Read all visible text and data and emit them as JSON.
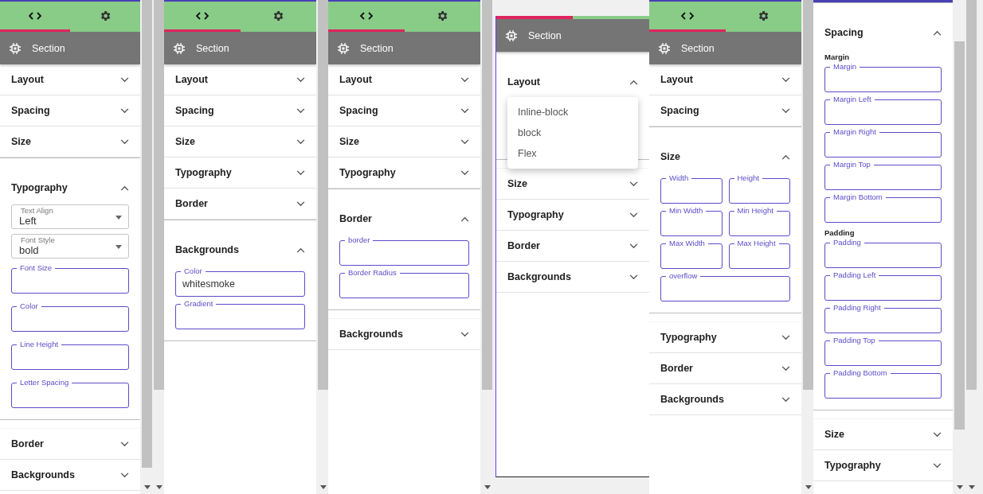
{
  "panels": [
    {
      "tabs": [
        {
          "selected": true
        },
        {
          "selected": false
        }
      ],
      "header": {
        "title": "Section"
      },
      "sections": [
        {
          "title": "Layout",
          "expanded": false
        },
        {
          "title": "Spacing",
          "expanded": false
        },
        {
          "title": "Size",
          "expanded": false
        },
        {
          "title": "Typography",
          "expanded": true,
          "fields": [
            {
              "kind": "select",
              "label": "Text Align",
              "value": "Left"
            },
            {
              "kind": "select",
              "label": "Font Style",
              "value": "bold"
            },
            {
              "kind": "outlined",
              "label": "Font Size"
            },
            {
              "kind": "outlined",
              "label": "Color"
            },
            {
              "kind": "outlined",
              "label": "Line Height"
            },
            {
              "kind": "outlined",
              "label": "Letter Spacing"
            }
          ]
        },
        {
          "title": "Border",
          "expanded": false
        },
        {
          "title": "Backgrounds",
          "expanded": false
        }
      ]
    },
    {
      "tabs": [
        {
          "selected": true
        },
        {
          "selected": false
        }
      ],
      "header": {
        "title": "Section"
      },
      "sections": [
        {
          "title": "Layout",
          "expanded": false
        },
        {
          "title": "Spacing",
          "expanded": false
        },
        {
          "title": "Size",
          "expanded": false
        },
        {
          "title": "Typography",
          "expanded": false
        },
        {
          "title": "Border",
          "expanded": false
        },
        {
          "title": "Backgrounds",
          "expanded": true,
          "fields": [
            {
              "kind": "outlined",
              "label": "Color",
              "value": "whitesmoke"
            },
            {
              "kind": "outlined",
              "label": "Gradient"
            }
          ]
        }
      ]
    },
    {
      "tabs": [
        {
          "selected": true
        },
        {
          "selected": false
        }
      ],
      "header": {
        "title": "Section"
      },
      "sections": [
        {
          "title": "Layout",
          "expanded": false
        },
        {
          "title": "Spacing",
          "expanded": false
        },
        {
          "title": "Size",
          "expanded": false
        },
        {
          "title": "Typography",
          "expanded": false
        },
        {
          "title": "Border",
          "expanded": true,
          "fields": [
            {
              "kind": "outlined",
              "label": "border"
            },
            {
              "kind": "outlined",
              "label": "Border Radius"
            }
          ]
        },
        {
          "title": "Backgrounds",
          "expanded": false
        }
      ]
    },
    {
      "tabs": [
        {
          "selected": true
        },
        {
          "selected": false
        }
      ],
      "header": {
        "title": "Section"
      },
      "sections": [
        {
          "title": "Layout",
          "expanded": true,
          "menu": [
            "Inline-block",
            "block",
            "Flex"
          ]
        },
        {
          "title": "Size",
          "expanded": false
        },
        {
          "title": "Typography",
          "expanded": false
        },
        {
          "title": "Border",
          "expanded": false
        },
        {
          "title": "Backgrounds",
          "expanded": false
        }
      ]
    },
    {
      "tabs": [
        {
          "selected": true
        },
        {
          "selected": false
        }
      ],
      "header": {
        "title": "Section"
      },
      "sections": [
        {
          "title": "Layout",
          "expanded": false
        },
        {
          "title": "Spacing",
          "expanded": false
        },
        {
          "title": "Size",
          "expanded": true,
          "fields": [
            {
              "kind": "outlined-half",
              "label": "Width"
            },
            {
              "kind": "outlined-half",
              "label": "Height"
            },
            {
              "kind": "outlined-half",
              "label": "Min Width"
            },
            {
              "kind": "outlined-half",
              "label": "Min Height"
            },
            {
              "kind": "outlined-half",
              "label": "Max Width"
            },
            {
              "kind": "outlined-half",
              "label": "Max Height"
            },
            {
              "kind": "outlined",
              "label": "overflow"
            }
          ]
        },
        {
          "title": "Typography",
          "expanded": false
        },
        {
          "title": "Border",
          "expanded": false
        },
        {
          "title": "Backgrounds",
          "expanded": false
        }
      ]
    },
    {
      "sections": [
        {
          "title": "Spacing",
          "expanded": true,
          "fields": [
            {
              "kind": "subheading",
              "label": "Margin"
            },
            {
              "kind": "outlined",
              "label": "Margin"
            },
            {
              "kind": "outlined",
              "label": "Margin Left"
            },
            {
              "kind": "outlined",
              "label": "Margin Right"
            },
            {
              "kind": "outlined",
              "label": "Margin Top"
            },
            {
              "kind": "outlined",
              "label": "Margin Bottom"
            },
            {
              "kind": "subheading",
              "label": "Padding"
            },
            {
              "kind": "outlined",
              "label": "Padding"
            },
            {
              "kind": "outlined",
              "label": "Padding Left"
            },
            {
              "kind": "outlined",
              "label": "Padding Right"
            },
            {
              "kind": "outlined",
              "label": "Padding Top"
            },
            {
              "kind": "outlined",
              "label": "Padding Bottom"
            }
          ]
        },
        {
          "title": "Size",
          "expanded": false
        },
        {
          "title": "Typography",
          "expanded": false
        }
      ]
    }
  ]
}
